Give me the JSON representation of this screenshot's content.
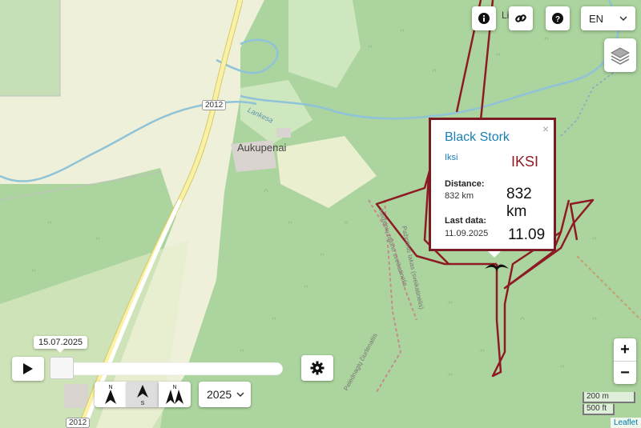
{
  "map": {
    "place_name": "Aukupenai",
    "place_name_partial": "Li",
    "road_number": "2012",
    "river_name": "Lankesa",
    "trail_1": "Kedainių rajono sveikatinėlis",
    "trail_2": "Pažintinis takas (sveikatinėlis)",
    "trail_3": "Pelėdnagių čiurlenaitis",
    "colors": {
      "track": "#8e1b23",
      "forest": "#a8d4a0",
      "field": "#f4f3dc",
      "road": "#f7f1a8"
    }
  },
  "popup": {
    "close": "×",
    "title": "Black Stork",
    "name_small": "Iksi",
    "name_big": "IKSI",
    "distance_label": "Distance:",
    "distance_small": "832 km",
    "distance_big": "832 km",
    "last_data_label": "Last data:",
    "last_data_small": "11.09.2025",
    "last_data_big": "11.09"
  },
  "toolbar": {
    "info_icon": "info-icon",
    "link_icon": "link-icon",
    "help_icon": "help-icon",
    "language": "EN",
    "layers_icon": "layers-icon"
  },
  "zoom": {
    "in": "+",
    "out": "−"
  },
  "scale": {
    "metric": "200 m",
    "imperial": "500 ft"
  },
  "attribution": "Leaflet",
  "timeline": {
    "date": "15.07.2025",
    "year": "2025",
    "compass_options": [
      "N",
      "S",
      "N"
    ]
  }
}
